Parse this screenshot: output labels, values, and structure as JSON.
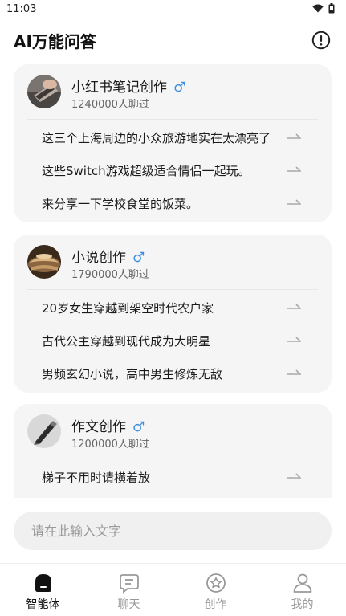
{
  "status_bar": {
    "time": "11:03",
    "icons": [
      "wifi-icon",
      "battery-icon"
    ]
  },
  "header": {
    "title": "AI万能问答",
    "info_icon": "info-icon"
  },
  "cards": [
    {
      "name": "小红书笔记创作",
      "gender_symbol": "♂",
      "count": "1240000人聊过",
      "prompts": [
        "这三个上海周边的小众旅游地实在太漂亮了",
        "这些Switch游戏超级适合情侣一起玩。",
        "来分享一下学校食堂的饭菜。"
      ]
    },
    {
      "name": "小说创作",
      "gender_symbol": "♂",
      "count": "1790000人聊过",
      "prompts": [
        "20岁女生穿越到架空时代农户家",
        "古代公主穿越到现代成为大明星",
        "男频玄幻小说，高中男生修炼无敌"
      ]
    },
    {
      "name": "作文创作",
      "gender_symbol": "♂",
      "count": "1200000人聊过",
      "prompts": [
        "梯子不用时请横着放"
      ]
    }
  ],
  "input": {
    "placeholder": "请在此输入文字",
    "value": ""
  },
  "tabs": [
    {
      "label": "智能体",
      "icon": "agent-icon",
      "active": true
    },
    {
      "label": "聊天",
      "icon": "chat-icon",
      "active": false
    },
    {
      "label": "创作",
      "icon": "create-star-icon",
      "active": false
    },
    {
      "label": "我的",
      "icon": "profile-icon",
      "active": false
    }
  ],
  "colors": {
    "accent_blue": "#3d8fe0",
    "card_bg": "#f5f5f5",
    "active_tab": "#111111",
    "inactive_tab": "#999999"
  }
}
